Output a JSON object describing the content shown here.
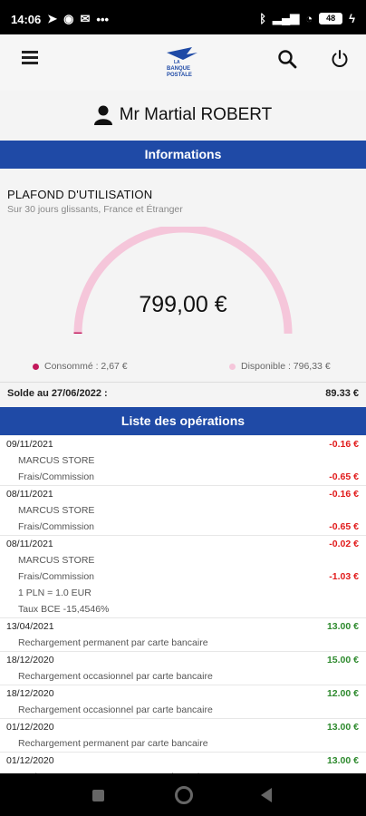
{
  "status_bar": {
    "time": "14:06",
    "battery": "48"
  },
  "header": {
    "logo_text": [
      "LA",
      "BANQUE",
      "POSTALE"
    ]
  },
  "user": {
    "name": "Mr Martial ROBERT"
  },
  "info_section": {
    "title": "Informations"
  },
  "plafond": {
    "title": "PLAFOND D'UTILISATION",
    "subtitle": "Sur 30 jours glissants, France et Étranger",
    "amount": "799,00 €",
    "consumed_fraction": 0.0033,
    "consumed_label": "Consommé : 2,67 €",
    "available_label": "Disponible : 796,33 €"
  },
  "solde": {
    "label": "Solde au 27/06/2022 :",
    "value": "89.33 €"
  },
  "operations_section": {
    "title": "Liste des opérations"
  },
  "operations": [
    {
      "date": "09/11/2021",
      "amount": "-0.16 €",
      "sign": "neg",
      "lines": [
        {
          "text": "MARCUS STORE",
          "amount": ""
        },
        {
          "text": "Frais/Commission",
          "amount": "-0.65 €"
        }
      ]
    },
    {
      "date": "08/11/2021",
      "amount": "-0.16 €",
      "sign": "neg",
      "lines": [
        {
          "text": "MARCUS STORE",
          "amount": ""
        },
        {
          "text": "Frais/Commission",
          "amount": "-0.65 €"
        }
      ]
    },
    {
      "date": "08/11/2021",
      "amount": "-0.02 €",
      "sign": "neg",
      "lines": [
        {
          "text": "MARCUS STORE",
          "amount": ""
        },
        {
          "text": "Frais/Commission",
          "amount": "-1.03 €"
        },
        {
          "text": "1 PLN = 1.0 EUR",
          "amount": ""
        },
        {
          "text": "Taux BCE -15,4546%",
          "amount": ""
        }
      ]
    },
    {
      "date": "13/04/2021",
      "amount": "13.00 €",
      "sign": "pos",
      "lines": [
        {
          "text": "Rechargement permanent par carte bancaire",
          "amount": ""
        }
      ]
    },
    {
      "date": "18/12/2020",
      "amount": "15.00 €",
      "sign": "pos",
      "lines": [
        {
          "text": "Rechargement occasionnel par carte bancaire",
          "amount": ""
        }
      ]
    },
    {
      "date": "18/12/2020",
      "amount": "12.00 €",
      "sign": "pos",
      "lines": [
        {
          "text": "Rechargement occasionnel par carte bancaire",
          "amount": ""
        }
      ]
    },
    {
      "date": "01/12/2020",
      "amount": "13.00 €",
      "sign": "pos",
      "lines": [
        {
          "text": "Rechargement permanent par carte bancaire",
          "amount": ""
        }
      ]
    },
    {
      "date": "01/12/2020",
      "amount": "13.00 €",
      "sign": "pos",
      "lines": [
        {
          "text": "Rechargement permanent par carte bancaire",
          "amount": ""
        }
      ]
    }
  ],
  "colors": {
    "brand_blue": "#1f4aa6",
    "gauge": "#f5c6da",
    "consumed_dot": "#c2185b",
    "available_dot": "#f5c6da",
    "negative": "#e11b1b",
    "positive": "#2e8a2e"
  },
  "icons": [
    "menu-icon",
    "search-icon",
    "power-icon",
    "user-icon"
  ]
}
